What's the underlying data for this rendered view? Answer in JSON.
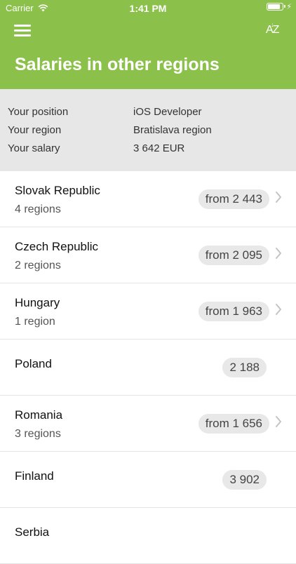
{
  "statusbar": {
    "carrier": "Carrier",
    "time": "1:41 PM",
    "battery_level": 0.9
  },
  "header": {
    "title": "Salaries in other regions",
    "menu_icon": "hamburger-menu-icon",
    "sort_icon": "sort-alphabetical-icon",
    "sort_glyph": "AZ",
    "accent_color": "#8bc04a"
  },
  "info": {
    "position_label": "Your position",
    "position_value": "iOS Developer",
    "region_label": "Your region",
    "region_value": "Bratislava region",
    "salary_label": "Your salary",
    "salary_value": "3 642 EUR"
  },
  "countries": [
    {
      "name": "Slovak Republic",
      "subtitle": "4 regions",
      "salary": "from 2 443",
      "has_children": true
    },
    {
      "name": "Czech Republic",
      "subtitle": "2 regions",
      "salary": "from 2 095",
      "has_children": true
    },
    {
      "name": "Hungary",
      "subtitle": "1 region",
      "salary": "from 1 963",
      "has_children": true
    },
    {
      "name": "Poland",
      "subtitle": "",
      "salary": "2 188",
      "has_children": false
    },
    {
      "name": "Romania",
      "subtitle": "3 regions",
      "salary": "from 1 656",
      "has_children": true
    },
    {
      "name": "Finland",
      "subtitle": "",
      "salary": "3 902",
      "has_children": false
    },
    {
      "name": "Serbia",
      "subtitle": "",
      "salary": "",
      "has_children": false
    }
  ]
}
